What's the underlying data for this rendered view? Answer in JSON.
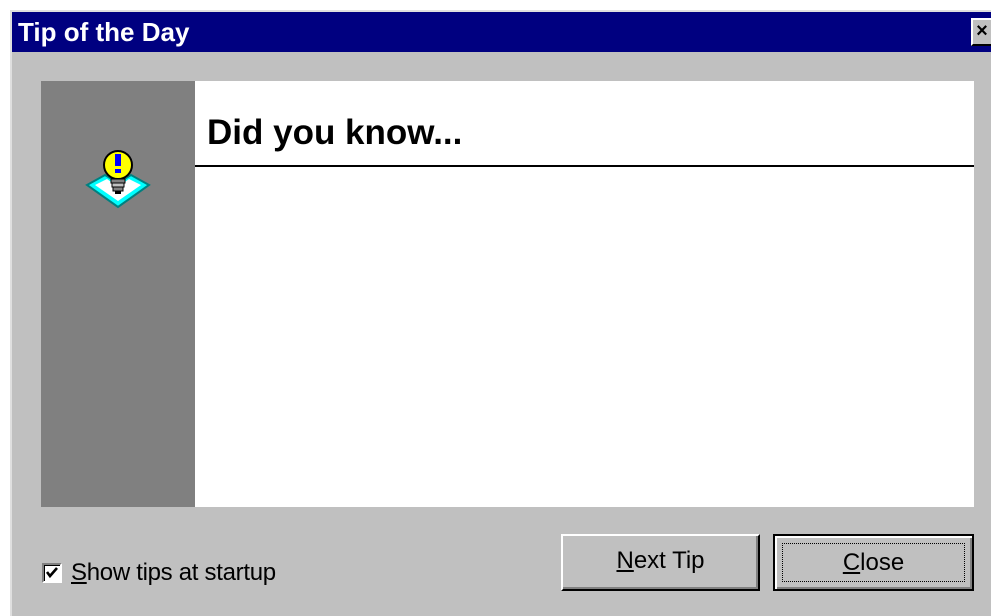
{
  "window": {
    "title": "Tip of the Day",
    "close_glyph": "×"
  },
  "tip": {
    "heading": "Did you know...",
    "body": "",
    "icon": "lightbulb-icon"
  },
  "startup": {
    "label_accel": "S",
    "label_rest": "how tips at startup",
    "checked": true
  },
  "buttons": {
    "next_accel": "N",
    "next_rest": "ext Tip",
    "close_accel": "C",
    "close_rest": "lose"
  },
  "colors": {
    "titlebar": "#000080",
    "face": "#c0c0c0",
    "side_strip": "#808080",
    "panel": "#ffffff",
    "bulb": "#ffff00",
    "bulb_glow": "#00ffff"
  }
}
